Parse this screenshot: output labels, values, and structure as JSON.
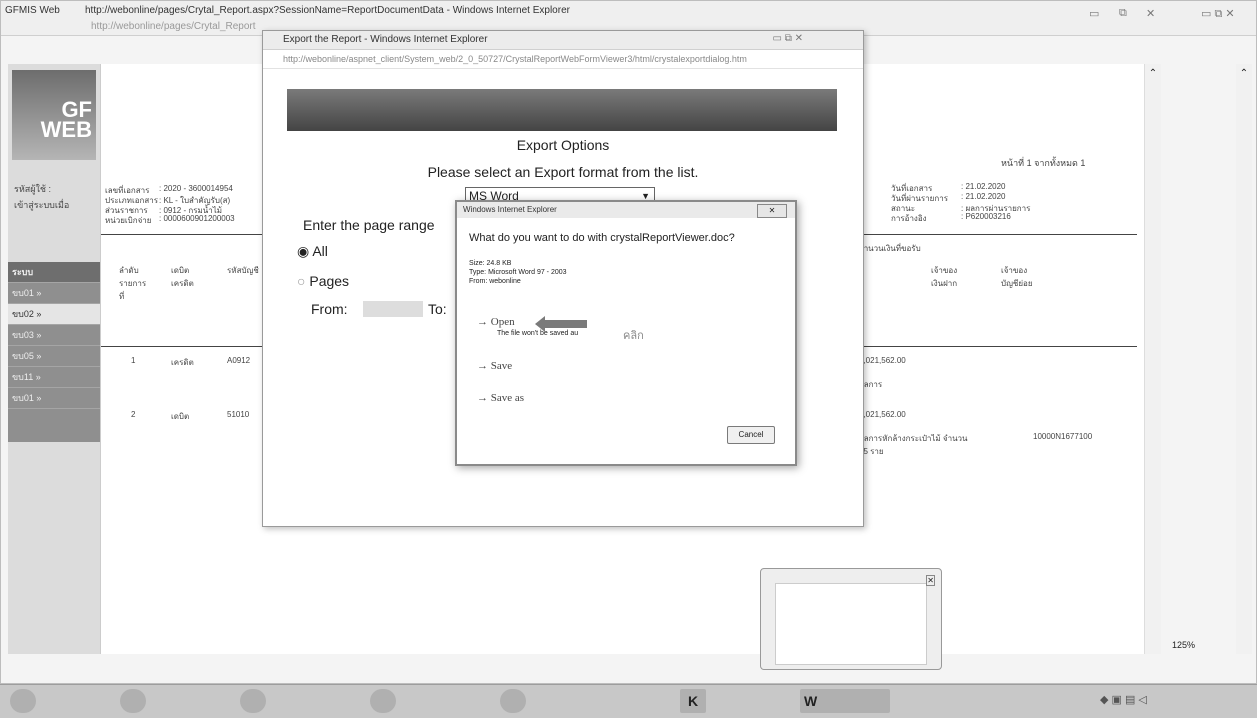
{
  "browser": {
    "tabs": [
      "GFMIS Web",
      "http://webonline/pages/Crytal_Report.aspx?SessionName=ReportDocumentData - Windows Internet Explorer"
    ],
    "address": "http://webonline/pages/Crytal_Report"
  },
  "sidebar": {
    "logo_line1": "GF",
    "logo_line2": "WEB",
    "info": [
      "รหัสผู้ใช้ :",
      "เข้าสู่ระบบเมื่อ"
    ],
    "menu": [
      "ระบบ",
      "ขบ01 »",
      "ขบ02 »",
      "ขบ03 »",
      "ขบ05 »",
      "ขบ11 »",
      "ขบ01 »"
    ]
  },
  "report": {
    "page_label": "หน้าที่ 1 จากทั้งหมด 1",
    "left_fields": [
      {
        "label": "เลขที่เอกสาร",
        "value": ": 2020 - 3600014954"
      },
      {
        "label": "ประเภทเอกสาร",
        "value": ": KL - ใบสำคัญรับ(ส)"
      },
      {
        "label": "ส่วนราชการ",
        "value": ": 0912 - กรมน้ำไม้"
      },
      {
        "label": "หน่วยเบิกจ่าย",
        "value": ": 0000600901200003"
      }
    ],
    "right_fields": [
      {
        "label": "วันที่เอกสาร",
        "value": ": 21.02.2020"
      },
      {
        "label": "วันที่ผ่านรายการ",
        "value": ": 21.02.2020"
      },
      {
        "label": "สถานะ",
        "value": ": ผลการผ่านรายการ"
      },
      {
        "label": "การอ้างอิง",
        "value": ": P620003216"
      }
    ],
    "table_headers": [
      "ลำดับ รายการที่",
      "เดบิต เครดิต",
      "รหัสบัญชี"
    ],
    "rows": [
      {
        "no": "1",
        "dc": "เครดิต",
        "acct": "A0912"
      },
      {
        "no": "2",
        "dc": "เดบิต",
        "acct": "51010"
      }
    ],
    "right_col_header": "จำนวนเงินที่ขอรับ",
    "right_cols": [
      "เจ้าของ เงินฝาก",
      "เจ้าของ บัญชีย่อย"
    ],
    "amounts": [
      "1,021,562.00",
      "1,021,562.00"
    ],
    "notes": [
      "ผลการ",
      "ผลการหักล้างกระเป๋าไม้ จำนวน 15 ราย"
    ],
    "ref": "10000N1677100"
  },
  "export_window": {
    "title": "Export the Report - Windows Internet Explorer",
    "address": "http://webonline/aspnet_client/System_web/2_0_50727/CrystalReportWebFormViewer3/html/crystalexportdialog.htm",
    "heading": "Export Options",
    "prompt": "Please select an Export format from the list.",
    "format_selected": "MS Word",
    "page_range_label": "Enter the page range",
    "radio_all": "All",
    "radio_pages": "Pages",
    "from_label": "From:",
    "to_label": "To:"
  },
  "dialog": {
    "title": "Windows Internet Explorer",
    "question": "What do you want to do with crystalReportViewer.doc?",
    "size": "Size: 24.8 KB",
    "type": "Type: Microsoft Word 97 - 2003",
    "from": "From: webonline",
    "open": "Open",
    "open_note": "The file won't be saved au",
    "thai_note": "คลิก",
    "save": "Save",
    "save_as": "Save as",
    "cancel": "Cancel"
  },
  "status": {
    "zoom": "125%"
  },
  "colors": {
    "banner": "#555555",
    "arrow": "#7a7a7a"
  }
}
